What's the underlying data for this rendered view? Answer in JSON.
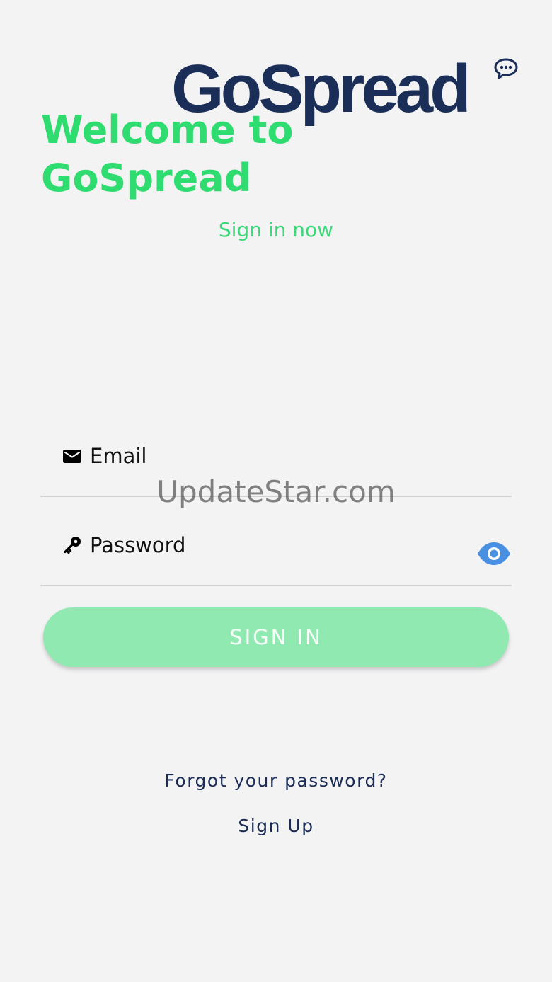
{
  "logo": {
    "text": "GoSpread",
    "icon": "speech-bubble-icon",
    "color": "#1a2e57"
  },
  "welcome": {
    "title": "Welcome to GoSpread",
    "subtitle": "Sign in now"
  },
  "form": {
    "email": {
      "icon": "mail-icon",
      "placeholder": "Email",
      "value": ""
    },
    "password": {
      "icon": "key-icon",
      "placeholder": "Password",
      "value": "",
      "toggle_icon": "eye-icon"
    },
    "signin_label": "SIGN IN"
  },
  "links": {
    "forgot": "Forgot your password?",
    "signup": "Sign Up"
  },
  "watermark": "UpdateStar.com",
  "colors": {
    "accent_green": "#2fdc6f",
    "button_green": "#90e9b0",
    "navy": "#1b2c55",
    "eye_blue": "#4a90e2",
    "background": "#f3f3f4"
  }
}
